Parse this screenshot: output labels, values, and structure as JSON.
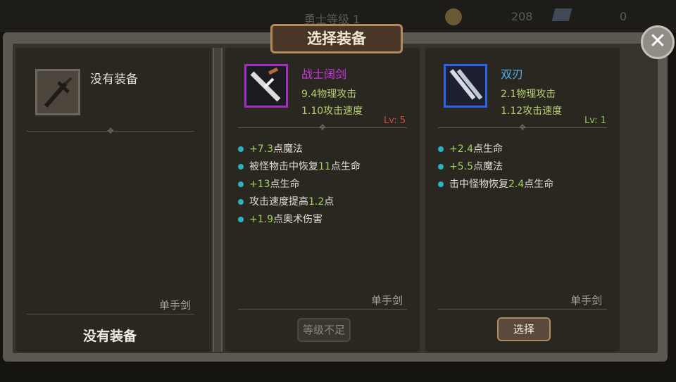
{
  "top_bar": {
    "level_text": "勇士等级 1",
    "coins": "208",
    "gems": "0"
  },
  "dialog": {
    "title": "选择装备"
  },
  "current": {
    "name": "没有装备",
    "type": "单手剑",
    "bottom_label": "没有装备"
  },
  "options": [
    {
      "name": "战士阔剑",
      "stats": [
        "9.4物理攻击",
        "1.10攻击速度"
      ],
      "level": "Lv: 5",
      "affixes": [
        {
          "pre": "+7.3",
          "post": "点魔法"
        },
        {
          "pre": "被怪物击中恢复",
          "num": "11",
          "post": "点生命"
        },
        {
          "pre": "+13",
          "post": "点生命"
        },
        {
          "pre": "攻击速度提高",
          "num": "1.2",
          "post": "点"
        },
        {
          "pre": "+1.9",
          "post": "点奥术伤害"
        }
      ],
      "type": "单手剑",
      "button": "等级不足",
      "rarity_color": "#a22ec7"
    },
    {
      "name": "双刃",
      "stats": [
        "2.1物理攻击",
        "1.12攻击速度"
      ],
      "level": "Lv: 1",
      "affixes": [
        {
          "pre": "+2.4",
          "post": "点生命"
        },
        {
          "pre": "+5.5",
          "post": "点魔法"
        },
        {
          "pre": "击中怪物恢复",
          "num": "2.4",
          "post": "点生命"
        }
      ],
      "type": "单手剑",
      "button": "选择",
      "rarity_color": "#2d63e8"
    }
  ]
}
